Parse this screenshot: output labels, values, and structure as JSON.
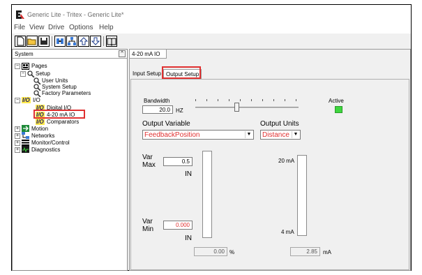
{
  "window": {
    "title": "Generic Lite - Tritex - Generic Lite*"
  },
  "menu": [
    "File",
    "View",
    "Drive",
    "Options",
    "Help"
  ],
  "left_pane": {
    "header": "System",
    "tree": [
      {
        "label": "Pages"
      },
      {
        "label": "Setup"
      },
      {
        "label": "User Units"
      },
      {
        "label": "System Setup"
      },
      {
        "label": "Factory Parameters"
      },
      {
        "label": "I/O",
        "badge": "I/O"
      },
      {
        "label": "Digital I/O",
        "badge": "I/O"
      },
      {
        "label": "4-20 mA IO",
        "badge": "I/O"
      },
      {
        "label": "Comparators",
        "badge": "I/O"
      },
      {
        "label": "Motion"
      },
      {
        "label": "Networks"
      },
      {
        "label": "Monitor/Control"
      },
      {
        "label": "Diagnostics"
      }
    ]
  },
  "document_tab": "4-20 mA IO",
  "sub_tabs": {
    "input": "Input Setup",
    "output": "Output Setup"
  },
  "form": {
    "bandwidth_label": "Bandwidth",
    "bandwidth_value": "20.0",
    "bandwidth_unit": "HZ",
    "slider_level": 0.4,
    "active_label": "Active",
    "output_variable_label": "Output Variable",
    "output_variable_value": "FeedbackPosition",
    "output_units_label": "Output Units",
    "output_units_value": "Distance",
    "var_max_label_1": "Var",
    "var_max_label_2": "Max",
    "var_max_value": "0.5",
    "var_max_unit": "IN",
    "var_min_label_1": "Var",
    "var_min_label_2": "Min",
    "var_min_value": "0.000",
    "var_min_unit": "IN",
    "percent_value": "0.00",
    "percent_unit": "%",
    "ma_20_label": "20 mA",
    "ma_4_label": "4 mA",
    "ma_value": "2.85",
    "ma_unit": "mA"
  },
  "colors": {
    "active_led": "#3ed63e",
    "highlight": "#e03030",
    "io_badge": "#ffe94a"
  }
}
